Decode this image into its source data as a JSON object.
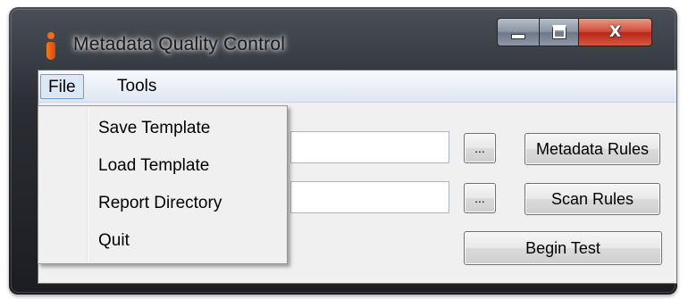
{
  "window": {
    "title": "Metadata Quality Control",
    "controls": {
      "minimize": "minimize",
      "maximize": "maximize",
      "close": "X"
    },
    "accent_color": "#f06a1c"
  },
  "menubar": {
    "items": [
      {
        "label": "File",
        "state": "open"
      },
      {
        "label": "Tools"
      }
    ]
  },
  "file_menu": {
    "items": [
      {
        "label": "Save Template"
      },
      {
        "label": "Load Template"
      },
      {
        "label": "Report Directory"
      },
      {
        "label": "Quit"
      }
    ]
  },
  "form": {
    "field1": {
      "value": "",
      "placeholder": ""
    },
    "field2": {
      "value": "",
      "placeholder": ""
    },
    "browse_label": "...",
    "metadata_rules_label": "Metadata Rules",
    "scan_rules_label": "Scan Rules",
    "begin_test_label": "Begin Test"
  }
}
